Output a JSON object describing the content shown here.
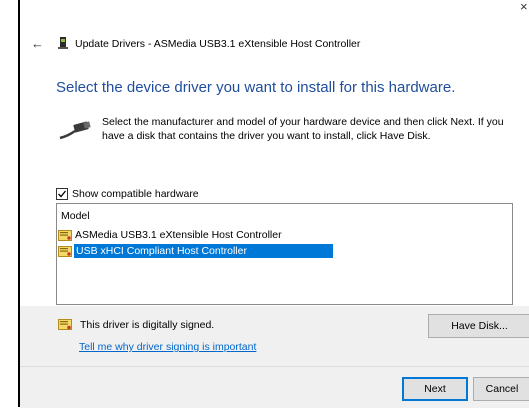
{
  "window": {
    "close_glyph": "×",
    "back_glyph": "←",
    "title": "Update Drivers - ASMedia USB3.1 eXtensible Host Controller"
  },
  "heading": "Select the device driver you want to install for this hardware.",
  "instructions": "Select the manufacturer and model of your hardware device and then click Next. If you have a disk that contains the driver you want to install, click Have Disk.",
  "compatible": {
    "label": "Show compatible hardware",
    "checked": true
  },
  "model_list": {
    "header": "Model",
    "items": [
      {
        "label": "ASMedia USB3.1 eXtensible Host Controller",
        "selected": false
      },
      {
        "label": "USB xHCI Compliant Host Controller",
        "selected": true
      }
    ]
  },
  "signing": {
    "status": "This driver is digitally signed.",
    "link": "Tell me why driver signing is important"
  },
  "buttons": {
    "have_disk": "Have Disk...",
    "next": "Next",
    "cancel": "Cancel"
  },
  "colors": {
    "heading": "#1f4e9c",
    "selection": "#0078d7",
    "link": "#0066cc",
    "panel": "#f0f0f0"
  }
}
